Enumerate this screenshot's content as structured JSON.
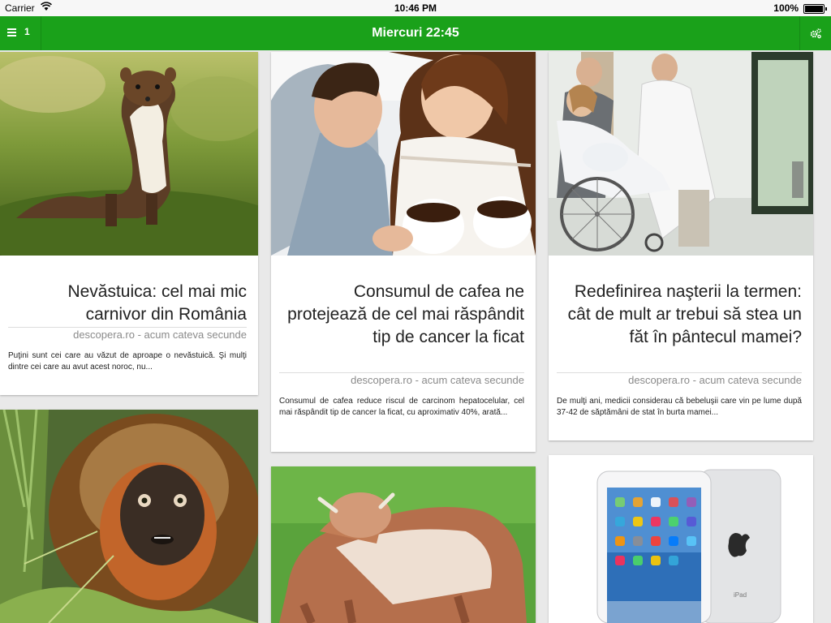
{
  "status_bar": {
    "carrier": "Carrier",
    "time": "10:46 PM",
    "battery": "100%"
  },
  "nav": {
    "menu_count": "1",
    "title": "Miercuri 22:45",
    "accent_color": "#1aa11a"
  },
  "articles": [
    {
      "title": "Nevăstuica: cel mai mic carnivor din România",
      "source": "descopera.ro - acum cateva secunde",
      "excerpt": "Puţini sunt cei care au văzut de aproape o nevăstuică. Şi mulţi dintre cei care au avut acest noroc, nu...",
      "image": "stoat-photo"
    },
    {
      "title": "Consumul de cafea ne protejează de cel mai răspândit tip de cancer la ficat",
      "source": "descopera.ro - acum cateva secunde",
      "excerpt": "Consumul de cafea reduce riscul de carcinom hepatocelular, cel mai răspândit tip de cancer la ficat, cu aproximativ 40%, arată...",
      "image": "couple-coffee-photo"
    },
    {
      "title": "Redefinirea naşterii la termen: cât de mult ar trebui să stea un făt în pântecul mamei?",
      "source": "descopera.ro - acum cateva secunde",
      "excerpt": "De mulţi ani, medicii considerau că bebeluşii care vin pe lume după 37-42 de săptămâni de stat în burta mamei...",
      "image": "pregnant-wheelchair-photo"
    },
    {
      "image": "monkey-photo"
    },
    {
      "image": "calf-photo"
    },
    {
      "image": "ipad-photo"
    }
  ]
}
